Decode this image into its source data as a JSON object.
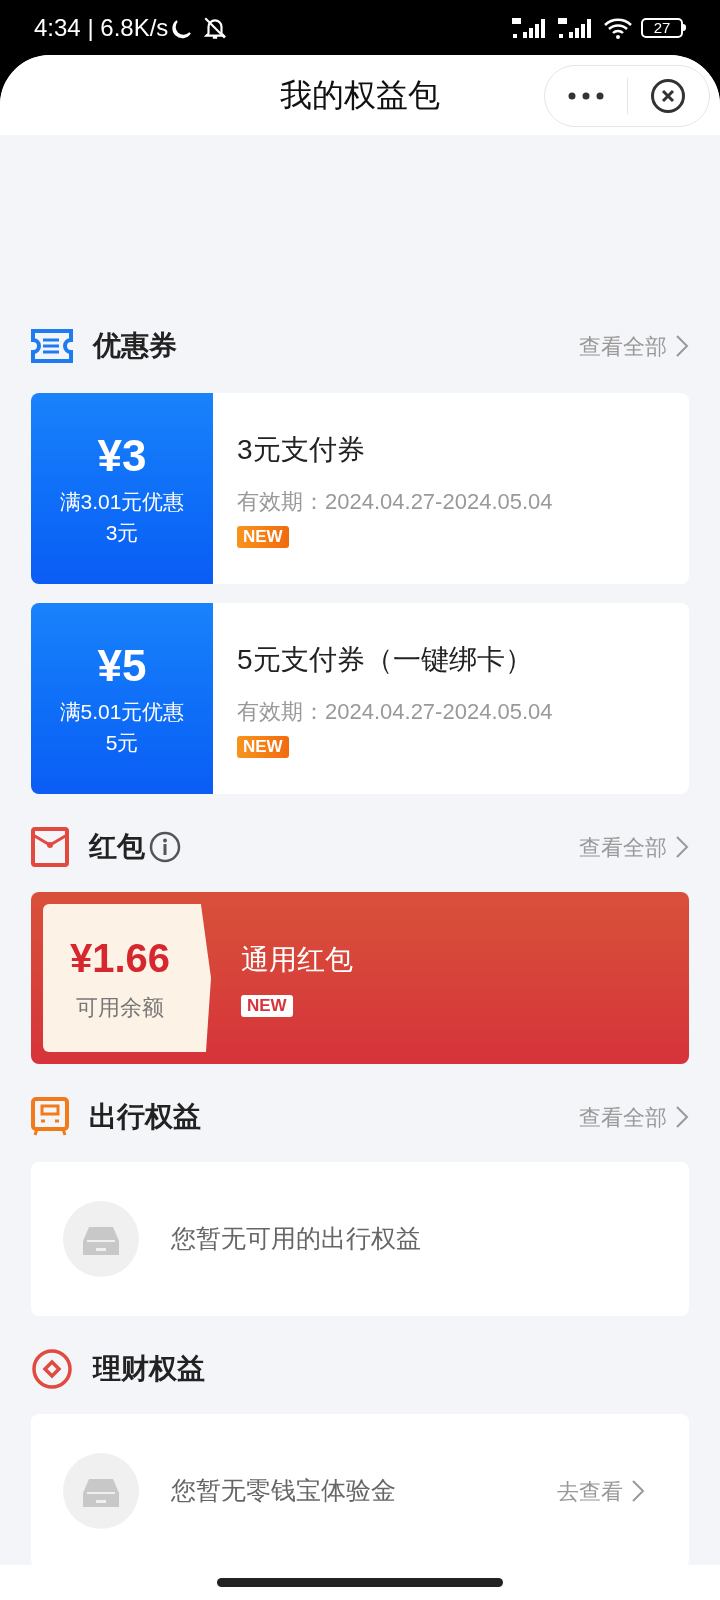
{
  "status_bar": {
    "time_speed": "4:34 | 6.8K/s",
    "battery": "27"
  },
  "header": {
    "title": "我的权益包"
  },
  "sections": [
    {
      "kind": "coupons",
      "title": "优惠券",
      "view_all": "查看全部",
      "coupons": [
        {
          "amount": "¥3",
          "condition": "满3.01元优惠\n3元",
          "name": "3元支付券",
          "validity": "有效期：2024.04.27-2024.05.04",
          "badge": "NEW"
        },
        {
          "amount": "¥5",
          "condition": "满5.01元优惠\n5元",
          "name": "5元支付券（一键绑卡）",
          "validity": "有效期：2024.04.27-2024.05.04",
          "badge": "NEW"
        }
      ]
    },
    {
      "kind": "red_packet",
      "title": "红包",
      "view_all": "查看全部",
      "packets": [
        {
          "amount": "¥1.66",
          "caption": "可用余额",
          "name": "通用红包",
          "badge": "NEW"
        }
      ]
    },
    {
      "kind": "travel",
      "title": "出行权益",
      "view_all": "查看全部",
      "message": "您暂无可用的出行权益"
    },
    {
      "kind": "finance",
      "title": "理财权益",
      "message": "您暂无零钱宝体验金",
      "link": "去查看"
    }
  ]
}
